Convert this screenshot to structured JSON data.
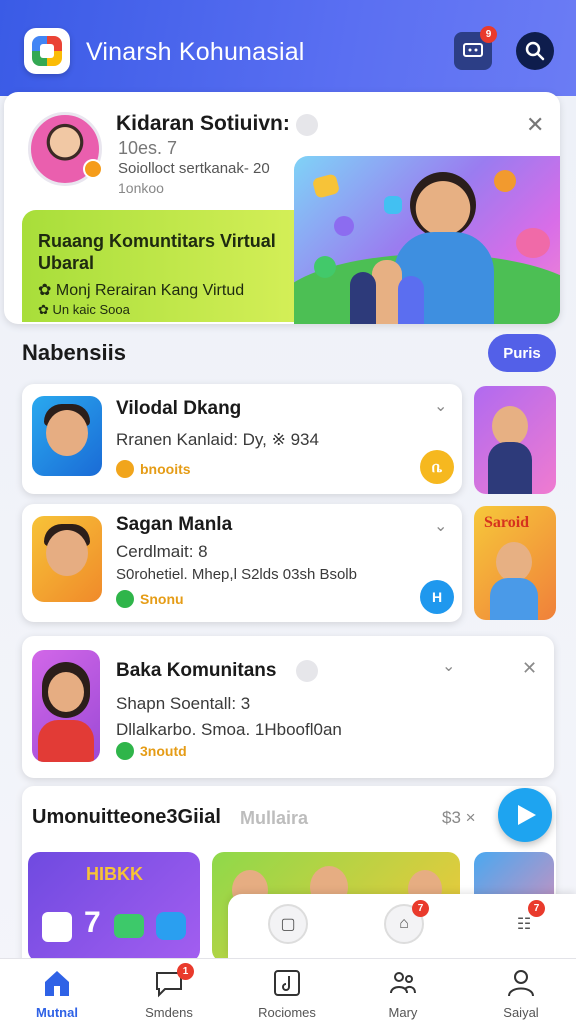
{
  "app": {
    "title": "Vinarsh Kohunasial",
    "chat_badge": "9"
  },
  "hero": {
    "name": "Kidaran Sotiuivn:",
    "line1": "10es. 7",
    "line2": "Soiolloct sertkanak- 20",
    "line3": "1onkoo",
    "banner_title": "Ruaang Komuntitars Virtual Ubaral",
    "banner_row1": "Monj Rerairan Kang Virtud",
    "banner_row2": "Un kaic Sooa"
  },
  "section": {
    "title": "Nabensiis",
    "pill": "Puris"
  },
  "cards": [
    {
      "name": "Vilodal Dkang",
      "meta1": "Rranen Kanlaid: Dy, ※ 934",
      "meta2": "",
      "tag": "bnooits",
      "tag_color": "#f1a51c",
      "action_color": "#f6b81f",
      "action_label": "ቤ"
    },
    {
      "name": "Sagan Manla",
      "meta1": "Cerdlmait: 8",
      "meta2": "S0rohetiel. Mhep,l S2lds 03sh Bsolb",
      "tag": "Snonu",
      "tag_color": "#2fb54a",
      "action_color": "#1f98ee",
      "action_label": "H"
    },
    {
      "name": "Baka Komunitans",
      "meta1": "Shapn Soentall: 3",
      "meta2": "Dllalkarbo. Smoa. 1Hboofl0an",
      "tag": "3noutd",
      "tag_color": "#2fb54a",
      "action_color": "",
      "action_label": ""
    }
  ],
  "featured": {
    "title": "Umonuitteone3Giial",
    "subtitle": "Mullaira",
    "price": "$3 ×",
    "tile1_text": "HIBKK",
    "tile1_number": "7"
  },
  "float_bar": {
    "badge1": "7",
    "badge2": "7"
  },
  "nav": [
    {
      "label": "Mutnal",
      "icon": "home-icon",
      "active": true
    },
    {
      "label": "Smdens",
      "icon": "chat-icon",
      "badge": "1"
    },
    {
      "label": "Rociomes",
      "icon": "music-icon"
    },
    {
      "label": "Mary",
      "icon": "community-icon"
    },
    {
      "label": "Saiyal",
      "icon": "profile-icon"
    }
  ],
  "colors": {
    "brand": "#3f5ee8",
    "accent": "#5360e8",
    "nav_active": "#2f62e6",
    "badge": "#e93a2c"
  }
}
